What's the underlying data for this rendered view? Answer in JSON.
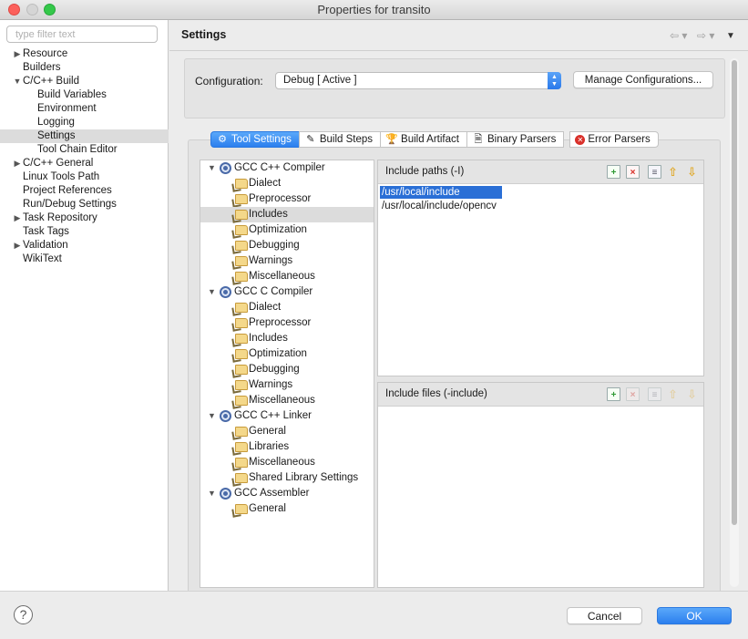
{
  "window": {
    "title": "Properties for transito"
  },
  "filter": {
    "placeholder": "type filter text"
  },
  "left_tree": [
    {
      "label": "Resource",
      "indent": 0,
      "expander": "right",
      "selected": false
    },
    {
      "label": "Builders",
      "indent": 0,
      "expander": "none",
      "selected": false
    },
    {
      "label": "C/C++ Build",
      "indent": 0,
      "expander": "down",
      "selected": false
    },
    {
      "label": "Build Variables",
      "indent": 1,
      "expander": "none",
      "selected": false
    },
    {
      "label": "Environment",
      "indent": 1,
      "expander": "none",
      "selected": false
    },
    {
      "label": "Logging",
      "indent": 1,
      "expander": "none",
      "selected": false
    },
    {
      "label": "Settings",
      "indent": 1,
      "expander": "none",
      "selected": true
    },
    {
      "label": "Tool Chain Editor",
      "indent": 1,
      "expander": "none",
      "selected": false
    },
    {
      "label": "C/C++ General",
      "indent": 0,
      "expander": "right",
      "selected": false
    },
    {
      "label": "Linux Tools Path",
      "indent": 0,
      "expander": "none",
      "selected": false
    },
    {
      "label": "Project References",
      "indent": 0,
      "expander": "none",
      "selected": false
    },
    {
      "label": "Run/Debug Settings",
      "indent": 0,
      "expander": "none",
      "selected": false
    },
    {
      "label": "Task Repository",
      "indent": 0,
      "expander": "right",
      "selected": false
    },
    {
      "label": "Task Tags",
      "indent": 0,
      "expander": "none",
      "selected": false
    },
    {
      "label": "Validation",
      "indent": 0,
      "expander": "right",
      "selected": false
    },
    {
      "label": "WikiText",
      "indent": 0,
      "expander": "none",
      "selected": false
    }
  ],
  "header": {
    "title": "Settings",
    "back_glyph": "⇦ ▾",
    "forward_glyph": "⇨ ▾",
    "menu_glyph": "▼"
  },
  "config": {
    "label": "Configuration:",
    "value": "Debug  [ Active ]",
    "manage_label": "Manage Configurations..."
  },
  "tabs": [
    {
      "label": "Tool Settings",
      "icon": "tool-settings-icon",
      "glyph": "⚙",
      "active": true
    },
    {
      "label": "Build Steps",
      "icon": "build-steps-icon",
      "glyph": "✎",
      "active": false
    },
    {
      "label": "Build Artifact",
      "icon": "trophy-icon",
      "glyph": "🏆",
      "active": false
    },
    {
      "label": "Binary Parsers",
      "icon": "binary-file-icon",
      "glyph": "🗎",
      "active": false
    },
    {
      "label": "Error Parsers",
      "icon": "error-icon",
      "glyph": "✕",
      "active": false
    }
  ],
  "tool_tree": [
    {
      "label": "GCC C++ Compiler",
      "type": "tool",
      "selected": false
    },
    {
      "label": "Dialect",
      "type": "option",
      "selected": false
    },
    {
      "label": "Preprocessor",
      "type": "option",
      "selected": false
    },
    {
      "label": "Includes",
      "type": "option",
      "selected": true
    },
    {
      "label": "Optimization",
      "type": "option",
      "selected": false
    },
    {
      "label": "Debugging",
      "type": "option",
      "selected": false
    },
    {
      "label": "Warnings",
      "type": "option",
      "selected": false
    },
    {
      "label": "Miscellaneous",
      "type": "option",
      "selected": false
    },
    {
      "label": "GCC C Compiler",
      "type": "tool",
      "selected": false
    },
    {
      "label": "Dialect",
      "type": "option",
      "selected": false
    },
    {
      "label": "Preprocessor",
      "type": "option",
      "selected": false
    },
    {
      "label": "Includes",
      "type": "option",
      "selected": false
    },
    {
      "label": "Optimization",
      "type": "option",
      "selected": false
    },
    {
      "label": "Debugging",
      "type": "option",
      "selected": false
    },
    {
      "label": "Warnings",
      "type": "option",
      "selected": false
    },
    {
      "label": "Miscellaneous",
      "type": "option",
      "selected": false
    },
    {
      "label": "GCC C++ Linker",
      "type": "tool",
      "selected": false
    },
    {
      "label": "General",
      "type": "option",
      "selected": false
    },
    {
      "label": "Libraries",
      "type": "option",
      "selected": false
    },
    {
      "label": "Miscellaneous",
      "type": "option",
      "selected": false
    },
    {
      "label": "Shared Library Settings",
      "type": "option",
      "selected": false
    },
    {
      "label": "GCC Assembler",
      "type": "tool",
      "selected": false
    },
    {
      "label": "General",
      "type": "option",
      "selected": false
    }
  ],
  "include_paths": {
    "title": "Include paths (-I)",
    "items": [
      {
        "value": "/usr/local/include",
        "selected": true
      },
      {
        "value": "/usr/local/include/opencv",
        "selected": false
      }
    ]
  },
  "include_files": {
    "title": "Include files (-include)",
    "items": []
  },
  "footer": {
    "help_glyph": "?",
    "cancel_label": "Cancel",
    "ok_label": "OK"
  }
}
